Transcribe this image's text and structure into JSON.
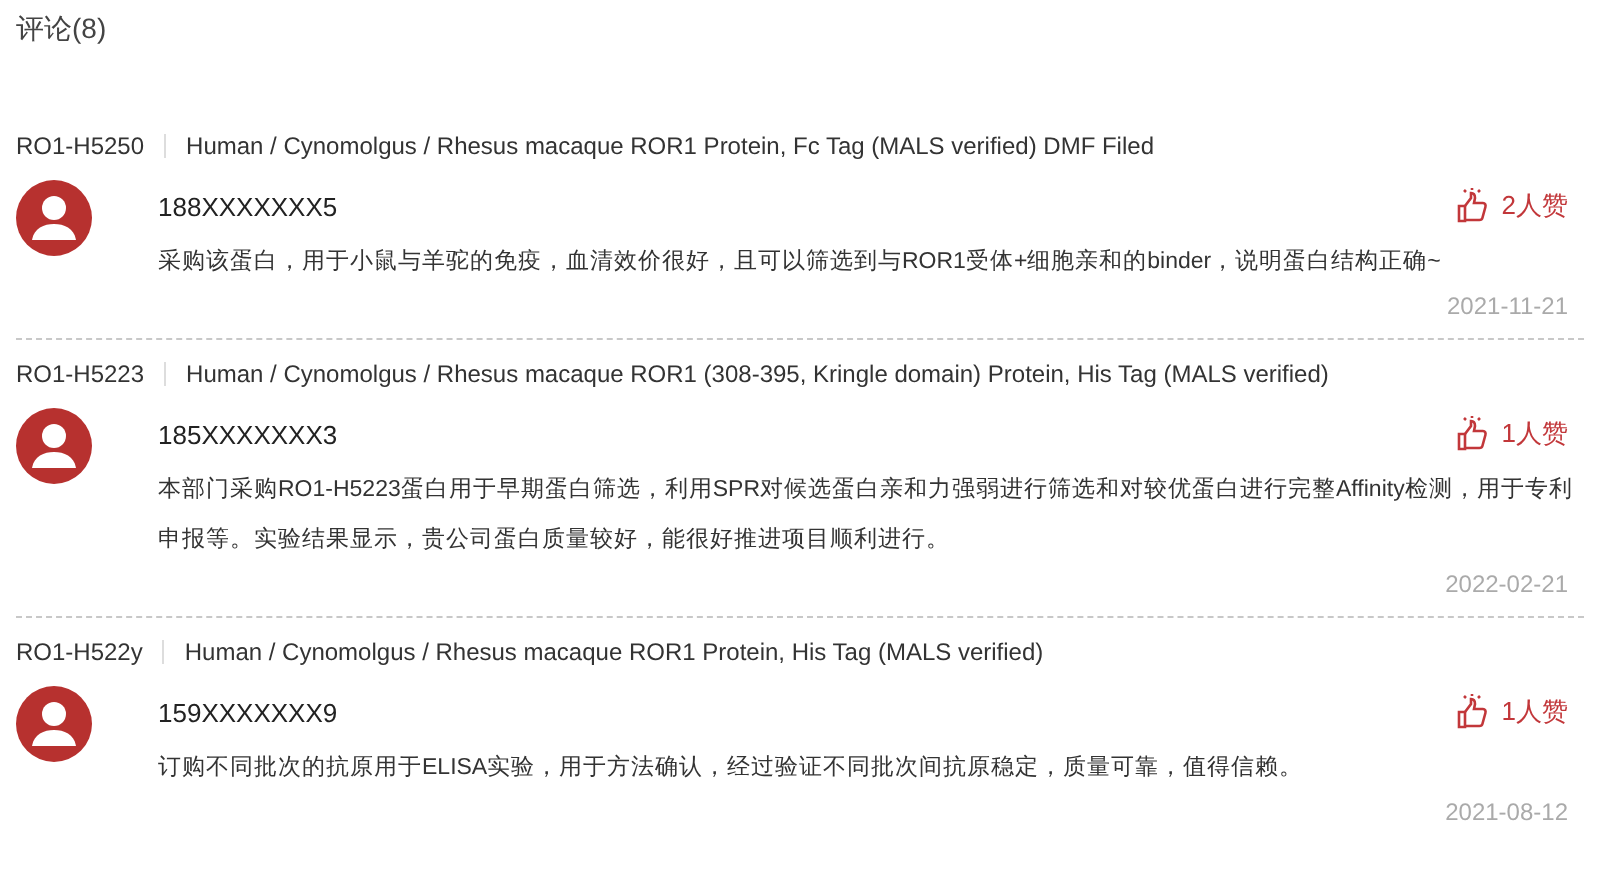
{
  "heading": "评论(8)",
  "reviews": [
    {
      "code": "RO1-H5250",
      "product": "Human / Cynomolgus / Rhesus macaque ROR1 Protein, Fc Tag (MALS verified) DMF Filed",
      "user": "188XXXXXXX5",
      "likes": "2人赞",
      "comment": "采购该蛋白，用于小鼠与羊驼的免疫，血清效价很好，且可以筛选到与ROR1受体+细胞亲和的binder，说明蛋白结构正确~",
      "date": "2021-11-21"
    },
    {
      "code": "RO1-H5223",
      "product": "Human / Cynomolgus / Rhesus macaque ROR1 (308-395, Kringle domain) Protein, His Tag (MALS verified)",
      "user": "185XXXXXXX3",
      "likes": "1人赞",
      "comment": "本部门采购RO1-H5223蛋白用于早期蛋白筛选，利用SPR对候选蛋白亲和力强弱进行筛选和对较优蛋白进行完整Affinity检测，用于专利申报等。实验结果显示，贵公司蛋白质量较好，能很好推进项目顺利进行。",
      "date": "2022-02-21"
    },
    {
      "code": "RO1-H522y",
      "product": "Human / Cynomolgus / Rhesus macaque ROR1 Protein, His Tag (MALS verified)",
      "user": "159XXXXXXX9",
      "likes": "1人赞",
      "comment": "订购不同批次的抗原用于ELISA实验，用于方法确认，经过验证不同批次间抗原稳定，质量可靠，值得信赖。",
      "date": "2021-08-12"
    }
  ]
}
